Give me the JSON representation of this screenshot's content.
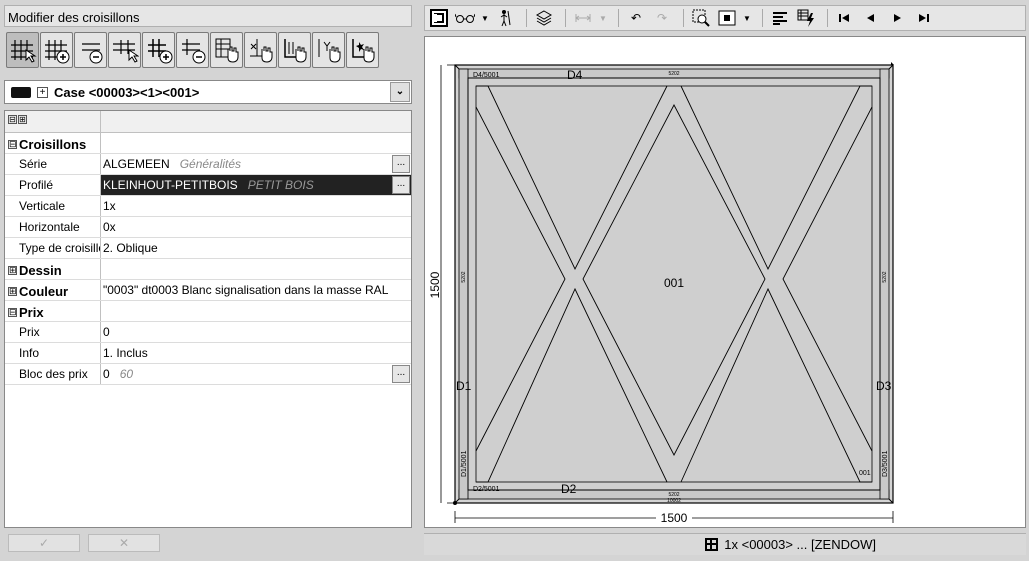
{
  "left_panel": {
    "title": "Modifier des croisillons",
    "tools": [
      "grid-select-icon",
      "grid-add-icon",
      "grid-remove-icon",
      "grid-horizontal-select-icon",
      "grid-add-alt-icon",
      "grid-remove-alt-icon",
      "grid-hand-icon",
      "grid-x-hand-icon",
      "grid-corner-hand-icon",
      "grid-y-hand-icon",
      "grid-star-hand-icon"
    ],
    "case": {
      "label": "Case <00003><1><001>",
      "expand": "+",
      "dropdown": "⌄"
    },
    "grid": {
      "header_icons": [
        "⊟",
        "⊞"
      ],
      "rows": [
        {
          "type": "cat",
          "exp": "⊟",
          "key": "Croisillons",
          "value": ""
        },
        {
          "type": "prop",
          "key": "Série",
          "value": "ALGEMEEN",
          "sub": "Généralités",
          "button": "..."
        },
        {
          "type": "prop",
          "key": "Profilé",
          "value": "KLEINHOUT-PETITBOIS",
          "sub": "PETIT BOIS",
          "button": "...",
          "selected": true
        },
        {
          "type": "prop",
          "key": "Verticale",
          "value": "1x"
        },
        {
          "type": "prop",
          "key": "Horizontale",
          "value": "0x"
        },
        {
          "type": "prop",
          "key": "Type de croisillon",
          "value": "2. Oblique"
        },
        {
          "type": "cat",
          "exp": "⊞",
          "key": "Dessin",
          "value": ""
        },
        {
          "type": "cat",
          "exp": "⊞",
          "key": "Couleur",
          "value": "\"0003\" dt0003 Blanc signalisation dans la masse RAL"
        },
        {
          "type": "cat",
          "exp": "⊟",
          "key": "Prix",
          "value": ""
        },
        {
          "type": "prop",
          "key": "Prix",
          "value": "0"
        },
        {
          "type": "prop",
          "key": "Info",
          "value": "1. Inclus"
        },
        {
          "type": "prop",
          "key": "Bloc des prix",
          "value": "0",
          "sub": "60",
          "button": "..."
        }
      ]
    },
    "ok_button": "✓",
    "cancel_button": "✕"
  },
  "right_panel": {
    "toolbar": [
      "view-mode-icon",
      "glasses-icon",
      "dropdown-arrow",
      "person-icon",
      "layers-icon",
      "measure-icon",
      "dropdown-arrow",
      "undo-icon",
      "redo-icon",
      "zoom-box-icon",
      "frame-icon",
      "dropdown-arrow",
      "align-icon",
      "filter-icon",
      "first-icon",
      "prev-icon",
      "next-icon",
      "last-icon"
    ],
    "drawing": {
      "width_dim": "1500",
      "height_dim": "1500",
      "center_label": "001",
      "top_label": "D4",
      "bottom_label": "D2",
      "left_label": "D1",
      "right_label": "D3",
      "top_left_tag": "D4/5001",
      "bottom_left_tag": "D2/5001",
      "left_bottom_tag": "D1/5001",
      "right_bottom_tag": "D3/5001",
      "corner_tag": "001",
      "mini_code": "5202",
      "mini_code_bottom": "10002"
    },
    "status": "1x <00003> ... [ZENDOW]"
  }
}
